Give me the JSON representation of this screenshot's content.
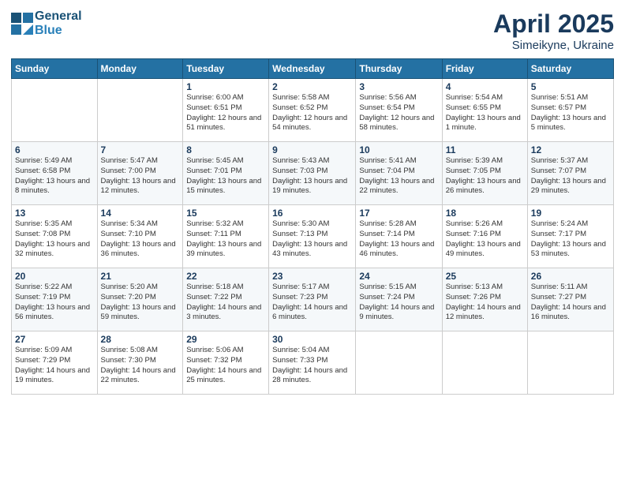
{
  "header": {
    "logo_line1": "General",
    "logo_line2": "Blue",
    "month_title": "April 2025",
    "subtitle": "Simeikyne, Ukraine"
  },
  "days_of_week": [
    "Sunday",
    "Monday",
    "Tuesday",
    "Wednesday",
    "Thursday",
    "Friday",
    "Saturday"
  ],
  "weeks": [
    [
      {
        "day": "",
        "info": ""
      },
      {
        "day": "",
        "info": ""
      },
      {
        "day": "1",
        "info": "Sunrise: 6:00 AM\nSunset: 6:51 PM\nDaylight: 12 hours\nand 51 minutes."
      },
      {
        "day": "2",
        "info": "Sunrise: 5:58 AM\nSunset: 6:52 PM\nDaylight: 12 hours\nand 54 minutes."
      },
      {
        "day": "3",
        "info": "Sunrise: 5:56 AM\nSunset: 6:54 PM\nDaylight: 12 hours\nand 58 minutes."
      },
      {
        "day": "4",
        "info": "Sunrise: 5:54 AM\nSunset: 6:55 PM\nDaylight: 13 hours\nand 1 minute."
      },
      {
        "day": "5",
        "info": "Sunrise: 5:51 AM\nSunset: 6:57 PM\nDaylight: 13 hours\nand 5 minutes."
      }
    ],
    [
      {
        "day": "6",
        "info": "Sunrise: 5:49 AM\nSunset: 6:58 PM\nDaylight: 13 hours\nand 8 minutes."
      },
      {
        "day": "7",
        "info": "Sunrise: 5:47 AM\nSunset: 7:00 PM\nDaylight: 13 hours\nand 12 minutes."
      },
      {
        "day": "8",
        "info": "Sunrise: 5:45 AM\nSunset: 7:01 PM\nDaylight: 13 hours\nand 15 minutes."
      },
      {
        "day": "9",
        "info": "Sunrise: 5:43 AM\nSunset: 7:03 PM\nDaylight: 13 hours\nand 19 minutes."
      },
      {
        "day": "10",
        "info": "Sunrise: 5:41 AM\nSunset: 7:04 PM\nDaylight: 13 hours\nand 22 minutes."
      },
      {
        "day": "11",
        "info": "Sunrise: 5:39 AM\nSunset: 7:05 PM\nDaylight: 13 hours\nand 26 minutes."
      },
      {
        "day": "12",
        "info": "Sunrise: 5:37 AM\nSunset: 7:07 PM\nDaylight: 13 hours\nand 29 minutes."
      }
    ],
    [
      {
        "day": "13",
        "info": "Sunrise: 5:35 AM\nSunset: 7:08 PM\nDaylight: 13 hours\nand 32 minutes."
      },
      {
        "day": "14",
        "info": "Sunrise: 5:34 AM\nSunset: 7:10 PM\nDaylight: 13 hours\nand 36 minutes."
      },
      {
        "day": "15",
        "info": "Sunrise: 5:32 AM\nSunset: 7:11 PM\nDaylight: 13 hours\nand 39 minutes."
      },
      {
        "day": "16",
        "info": "Sunrise: 5:30 AM\nSunset: 7:13 PM\nDaylight: 13 hours\nand 43 minutes."
      },
      {
        "day": "17",
        "info": "Sunrise: 5:28 AM\nSunset: 7:14 PM\nDaylight: 13 hours\nand 46 minutes."
      },
      {
        "day": "18",
        "info": "Sunrise: 5:26 AM\nSunset: 7:16 PM\nDaylight: 13 hours\nand 49 minutes."
      },
      {
        "day": "19",
        "info": "Sunrise: 5:24 AM\nSunset: 7:17 PM\nDaylight: 13 hours\nand 53 minutes."
      }
    ],
    [
      {
        "day": "20",
        "info": "Sunrise: 5:22 AM\nSunset: 7:19 PM\nDaylight: 13 hours\nand 56 minutes."
      },
      {
        "day": "21",
        "info": "Sunrise: 5:20 AM\nSunset: 7:20 PM\nDaylight: 13 hours\nand 59 minutes."
      },
      {
        "day": "22",
        "info": "Sunrise: 5:18 AM\nSunset: 7:22 PM\nDaylight: 14 hours\nand 3 minutes."
      },
      {
        "day": "23",
        "info": "Sunrise: 5:17 AM\nSunset: 7:23 PM\nDaylight: 14 hours\nand 6 minutes."
      },
      {
        "day": "24",
        "info": "Sunrise: 5:15 AM\nSunset: 7:24 PM\nDaylight: 14 hours\nand 9 minutes."
      },
      {
        "day": "25",
        "info": "Sunrise: 5:13 AM\nSunset: 7:26 PM\nDaylight: 14 hours\nand 12 minutes."
      },
      {
        "day": "26",
        "info": "Sunrise: 5:11 AM\nSunset: 7:27 PM\nDaylight: 14 hours\nand 16 minutes."
      }
    ],
    [
      {
        "day": "27",
        "info": "Sunrise: 5:09 AM\nSunset: 7:29 PM\nDaylight: 14 hours\nand 19 minutes."
      },
      {
        "day": "28",
        "info": "Sunrise: 5:08 AM\nSunset: 7:30 PM\nDaylight: 14 hours\nand 22 minutes."
      },
      {
        "day": "29",
        "info": "Sunrise: 5:06 AM\nSunset: 7:32 PM\nDaylight: 14 hours\nand 25 minutes."
      },
      {
        "day": "30",
        "info": "Sunrise: 5:04 AM\nSunset: 7:33 PM\nDaylight: 14 hours\nand 28 minutes."
      },
      {
        "day": "",
        "info": ""
      },
      {
        "day": "",
        "info": ""
      },
      {
        "day": "",
        "info": ""
      }
    ]
  ]
}
